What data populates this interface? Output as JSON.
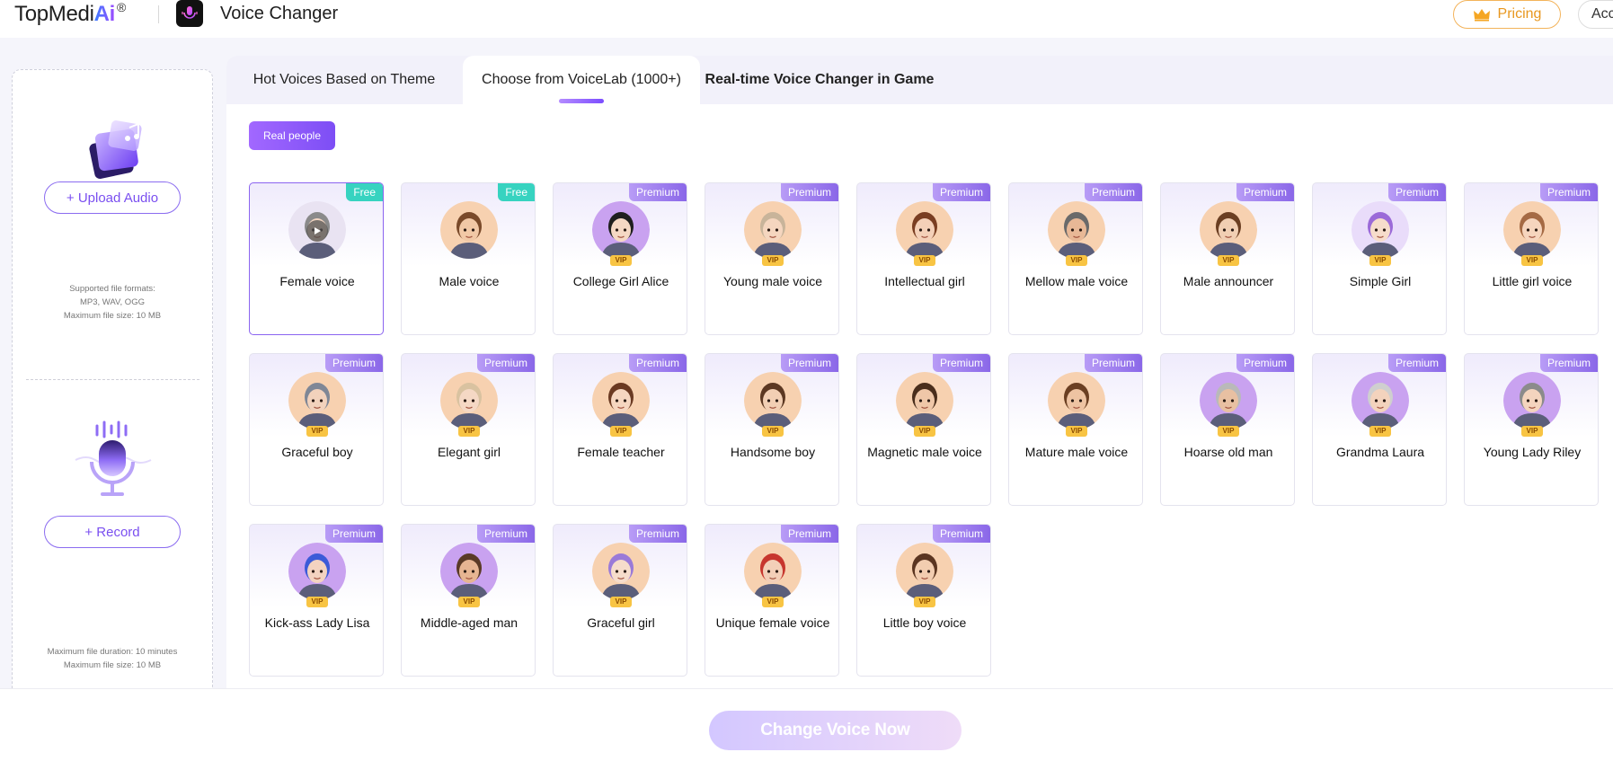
{
  "header": {
    "brand": "TopMedi",
    "brand_ai": "Ai",
    "brand_reg": "®",
    "app_title": "Voice Changer",
    "pricing_label": "Pricing",
    "account_label": "Acc"
  },
  "left_panel": {
    "upload_label": "+ Upload Audio",
    "formats_line1": "Supported file formats:",
    "formats_line2": "MP3, WAV, OGG",
    "formats_line3": "Maximum file size: 10 MB",
    "record_label": "+ Record",
    "record_note1": "Maximum file duration: 10 minutes",
    "record_note2": "Maximum file size: 10 MB"
  },
  "tabs": [
    {
      "label": "Hot Voices Based on Theme"
    },
    {
      "label": "Choose from VoiceLab (1000+)"
    },
    {
      "label": "Real-time Voice Changer in Game"
    }
  ],
  "filter_chip": "Real people",
  "voices": [
    {
      "name": "Female voice",
      "badge": "Free",
      "vip": "",
      "hair": "#8a8a8a",
      "skin": "#f3d6c2",
      "ring": "#e9e3f2"
    },
    {
      "name": "Male voice",
      "badge": "Free",
      "vip": "",
      "hair": "#7a4a2a",
      "skin": "#f1c8a6",
      "ring": "#f7d1b0"
    },
    {
      "name": "College Girl Alice",
      "badge": "Premium",
      "vip": "VIP",
      "hair": "#1f1f1f",
      "skin": "#f5d8c4",
      "ring": "#c9a2f0"
    },
    {
      "name": "Young male voice",
      "badge": "Premium",
      "vip": "VIP",
      "hair": "#c8b49a",
      "skin": "#f5d6bf",
      "ring": "#f7d1b0"
    },
    {
      "name": "Intellectual girl",
      "badge": "Premium",
      "vip": "VIP",
      "hair": "#7a3e22",
      "skin": "#f4d0b8",
      "ring": "#f7d1b0"
    },
    {
      "name": "Mellow male voice",
      "badge": "Premium",
      "vip": "VIP",
      "hair": "#6a6a6a",
      "skin": "#e8b896",
      "ring": "#f7d1b0"
    },
    {
      "name": "Male announcer",
      "badge": "Premium",
      "vip": "VIP",
      "hair": "#6b3f22",
      "skin": "#f1cfb3",
      "ring": "#f7d1b0"
    },
    {
      "name": "Simple Girl",
      "badge": "Premium",
      "vip": "VIP",
      "hair": "#9b6ad8",
      "skin": "#f6dccb",
      "ring": "#e9dcfa"
    },
    {
      "name": "Little girl voice",
      "badge": "Premium",
      "vip": "VIP",
      "hair": "#a56a44",
      "skin": "#f6d5be",
      "ring": "#f7d1b0"
    },
    {
      "name": "Graceful boy",
      "badge": "Premium",
      "vip": "VIP",
      "hair": "#7f8796",
      "skin": "#f2d2bc",
      "ring": "#f7d1b0"
    },
    {
      "name": "Elegant girl",
      "badge": "Premium",
      "vip": "VIP",
      "hair": "#d9c2a0",
      "skin": "#f5d8c4",
      "ring": "#f7d1b0"
    },
    {
      "name": "Female teacher",
      "badge": "Premium",
      "vip": "VIP",
      "hair": "#6b3a22",
      "skin": "#f5d6c0",
      "ring": "#f7d1b0"
    },
    {
      "name": "Handsome boy",
      "badge": "Premium",
      "vip": "VIP",
      "hair": "#5c3822",
      "skin": "#f2cfb4",
      "ring": "#f7d1b0"
    },
    {
      "name": "Magnetic male voice",
      "badge": "Premium",
      "vip": "VIP",
      "hair": "#4a2e1c",
      "skin": "#efc7a8",
      "ring": "#f7d1b0"
    },
    {
      "name": "Mature male voice",
      "badge": "Premium",
      "vip": "VIP",
      "hair": "#6b3f22",
      "skin": "#eec3a2",
      "ring": "#f7d1b0"
    },
    {
      "name": "Hoarse old man",
      "badge": "Premium",
      "vip": "VIP",
      "hair": "#b9b9b9",
      "skin": "#e8c0a2",
      "ring": "#c9a2f0"
    },
    {
      "name": "Grandma Laura",
      "badge": "Premium",
      "vip": "VIP",
      "hair": "#cfcfcf",
      "skin": "#f3d3bd",
      "ring": "#c9a2f0"
    },
    {
      "name": "Young Lady Riley",
      "badge": "Premium",
      "vip": "VIP",
      "hair": "#8b8b8b",
      "skin": "#f4d4be",
      "ring": "#c9a2f0"
    },
    {
      "name": "Kick-ass Lady Lisa",
      "badge": "Premium",
      "vip": "VIP",
      "hair": "#3c5bd8",
      "skin": "#f3d3c0",
      "ring": "#c9a2f0"
    },
    {
      "name": "Middle-aged man",
      "badge": "Premium",
      "vip": "VIP",
      "hair": "#5a3a26",
      "skin": "#e6b592",
      "ring": "#c9a2f0"
    },
    {
      "name": "Graceful girl",
      "badge": "Premium",
      "vip": "VIP",
      "hair": "#9a7ad8",
      "skin": "#f6dccb",
      "ring": "#f7d1b0"
    },
    {
      "name": "Unique female voice",
      "badge": "Premium",
      "vip": "VIP",
      "hair": "#c7362e",
      "skin": "#f3cfb8",
      "ring": "#f7d1b0"
    },
    {
      "name": "Little boy voice",
      "badge": "Premium",
      "vip": "VIP",
      "hair": "#5b3520",
      "skin": "#f2cdb0",
      "ring": "#f7d1b0"
    }
  ],
  "selected_voice": "Female voice",
  "cta_label": "Change Voice Now",
  "colors": {
    "accent": "#8b64f0",
    "free_badge": "#37d3c0",
    "vip_badge": "#f8c443",
    "pricing": "#e8971f"
  }
}
